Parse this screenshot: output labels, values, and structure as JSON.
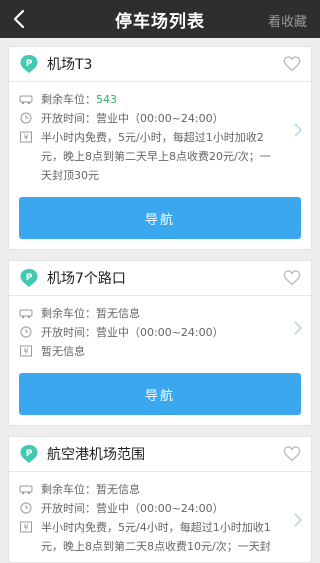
{
  "header": {
    "title": "停车场列表",
    "right_label": "看收藏"
  },
  "parking_list": [
    {
      "name": "机场T3",
      "remaining_label": "剩余车位：",
      "remaining_value": "543",
      "hours_label": "开放时间：",
      "hours_value": "营业中（00:00~24:00）",
      "fee_text": "半小时内免费，5元/小时，每超过1小时加收2元，晚上8点到第二天早上8点收费20元/次；一天封顶30元",
      "nav_label": "导航"
    },
    {
      "name": "机场7个路口",
      "remaining_label": "剩余车位：",
      "remaining_value": "暂无信息",
      "hours_label": "开放时间：",
      "hours_value": "营业中（00:00~24:00）",
      "fee_text": "暂无信息",
      "nav_label": "导航"
    },
    {
      "name": "航空港机场范围",
      "remaining_label": "剩余车位：",
      "remaining_value": "暂无信息",
      "hours_label": "开放时间：",
      "hours_value": "营业中（00:00~24:00）",
      "fee_text": "半小时内免费，5元/4小时，每超过1小时加收1元，晚上8点到第二天8点收费10元/次；一天封"
    }
  ],
  "icons": {
    "back": "back-arrow-icon",
    "pin": "parking-pin-icon",
    "heart": "heart-icon",
    "car": "car-icon",
    "clock": "clock-icon",
    "fee": "fee-icon",
    "chevron": "chevron-right-icon"
  },
  "colors": {
    "topbar": "#2e2e2e",
    "accent": "#3ba7ee",
    "pin": "#41c9b1",
    "green": "#2fb65c"
  }
}
